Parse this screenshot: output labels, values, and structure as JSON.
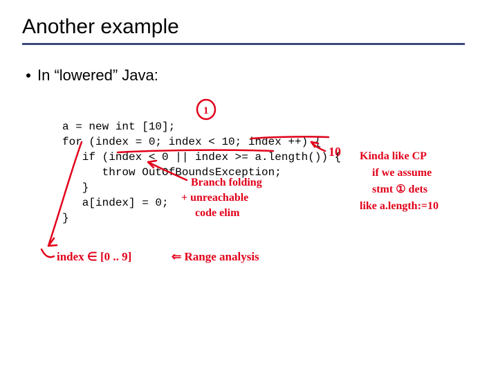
{
  "title": "Another example",
  "bullet": "In “lowered” Java:",
  "code": {
    "l1": "a = new int [10];",
    "l2": "for (index = 0; index < 10; index ++) {",
    "l3": "   if (index < 0 || index >= a.length()) {",
    "l4": "      throw OutOfBoundsException;",
    "l5": "   }",
    "l6": "   a[index] = 0;",
    "l7": "}"
  },
  "annot": {
    "label_1_circled": "1",
    "ten_with_arrow": "10",
    "branch_folding_l1": "Branch folding",
    "branch_folding_l2": "+ unreachable",
    "branch_folding_l3": "code elim",
    "cp_l1": "Kinda like CP",
    "cp_l2": "if we assume",
    "cp_l3": "stmt ① dets",
    "cp_l4": "like a.length:=10",
    "index_range": "index ∈ [0 .. 9]",
    "range_analysis": "⇐ Range analysis"
  }
}
